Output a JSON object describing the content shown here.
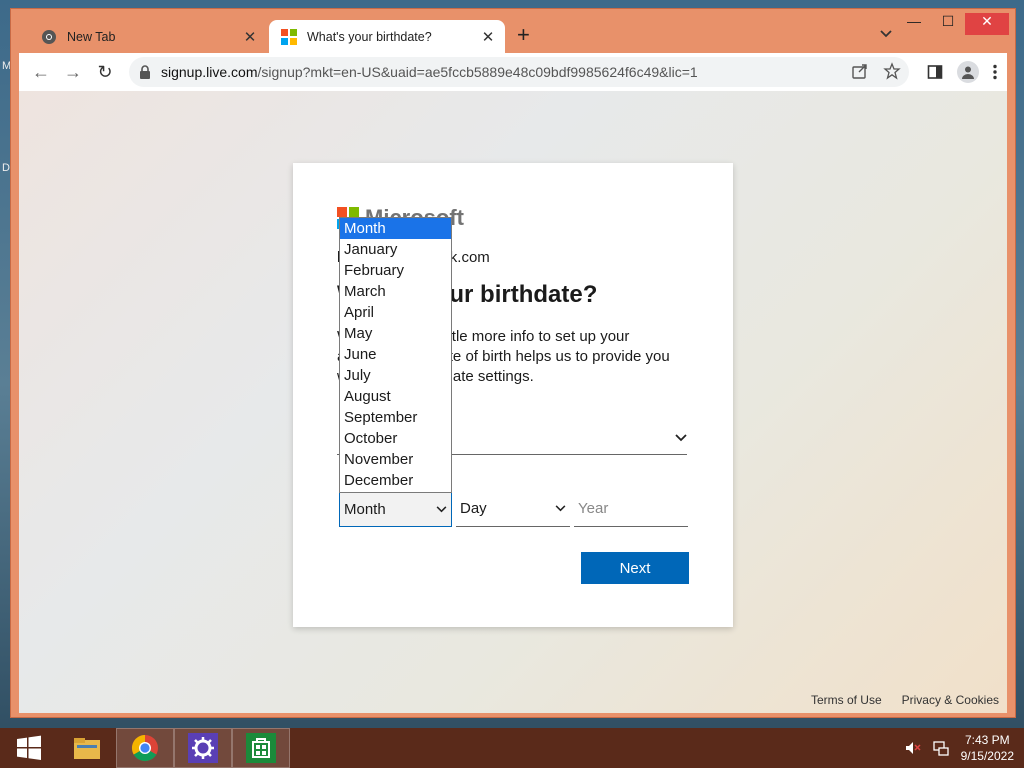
{
  "browser": {
    "tabs": [
      {
        "label": "New Tab"
      },
      {
        "label": "What's your birthdate?"
      }
    ],
    "url_host": "signup.live.com",
    "url_path": "/signup?mkt=en-US&uaid=ae5fccb5889e48c09bdf9985624f6c49&lic=1"
  },
  "card": {
    "logo_text": "Microsoft",
    "email": "kwcyslfn@outlook.com",
    "heading": "What's your birthdate?",
    "description": "We need just a little more info to set up your account. Your date of birth helps us to provide you with age-appropriate settings.",
    "dob": {
      "month_value": "Month",
      "day_value": "Day",
      "year_placeholder": "Year"
    },
    "next_label": "Next"
  },
  "month_dropdown": {
    "options": [
      "Month",
      "January",
      "February",
      "March",
      "April",
      "May",
      "June",
      "July",
      "August",
      "September",
      "October",
      "November",
      "December"
    ],
    "selected": "Month"
  },
  "footer": {
    "terms": "Terms of Use",
    "privacy": "Privacy & Cookies"
  },
  "taskbar": {
    "time": "7:43 PM",
    "date": "9/15/2022"
  },
  "colors": {
    "accent": "#0067b8",
    "titlebar": "#e8916a",
    "taskbar": "#5a2a1a"
  }
}
